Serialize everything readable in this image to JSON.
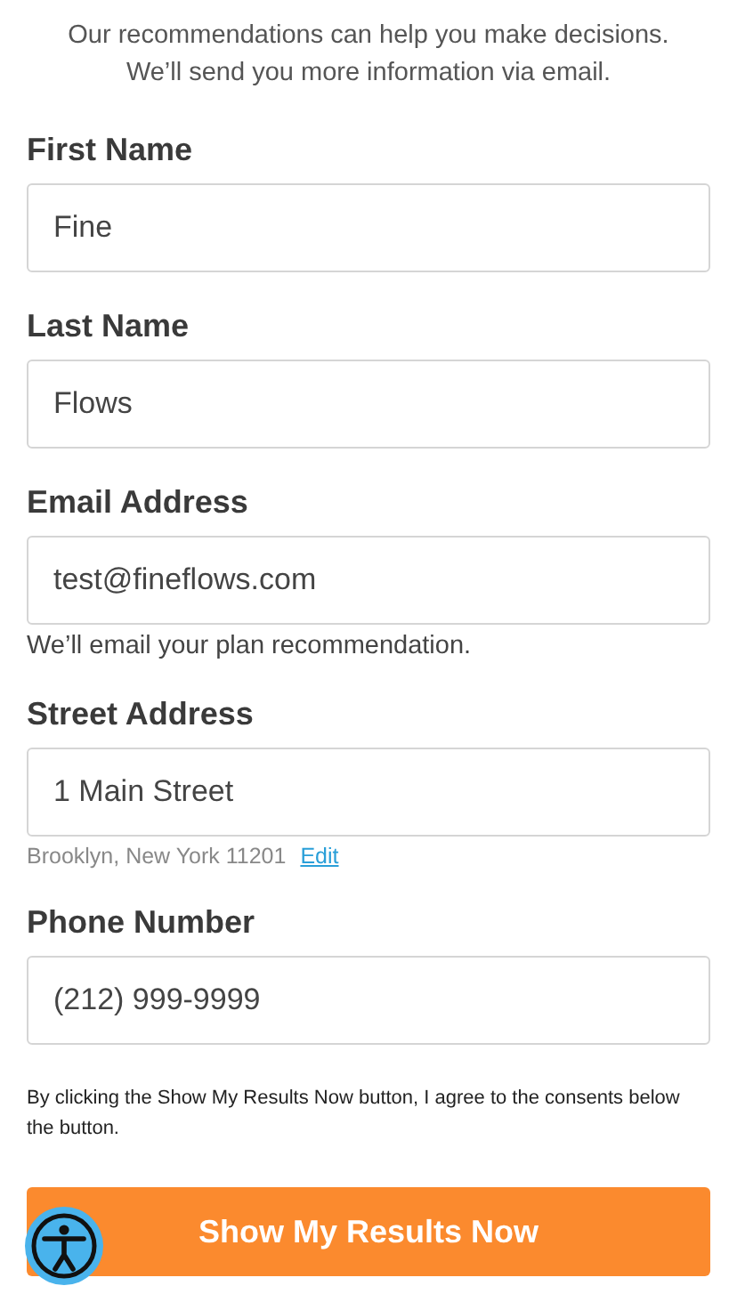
{
  "intro": [
    "Our recommendations can help you make decisions.",
    "We’ll send you more information via email."
  ],
  "fields": [
    {
      "label": "First Name",
      "value": "Fine"
    },
    {
      "label": "Last Name",
      "value": "Flows"
    },
    {
      "label": "Email Address",
      "value": "test@fineflows.com",
      "note": {
        "kind": "hint",
        "text": "We’ll email your plan recommendation."
      }
    },
    {
      "label": "Street Address",
      "value": "1 Main Street",
      "note": {
        "kind": "address",
        "text": "Brooklyn, New York 11201",
        "link": "Edit"
      }
    },
    {
      "label": "Phone Number",
      "value": "(212) 999-9999"
    }
  ],
  "consent": "By clicking the Show My Results Now button, I agree to the consents below the button.",
  "submit": "Show My Results Now"
}
